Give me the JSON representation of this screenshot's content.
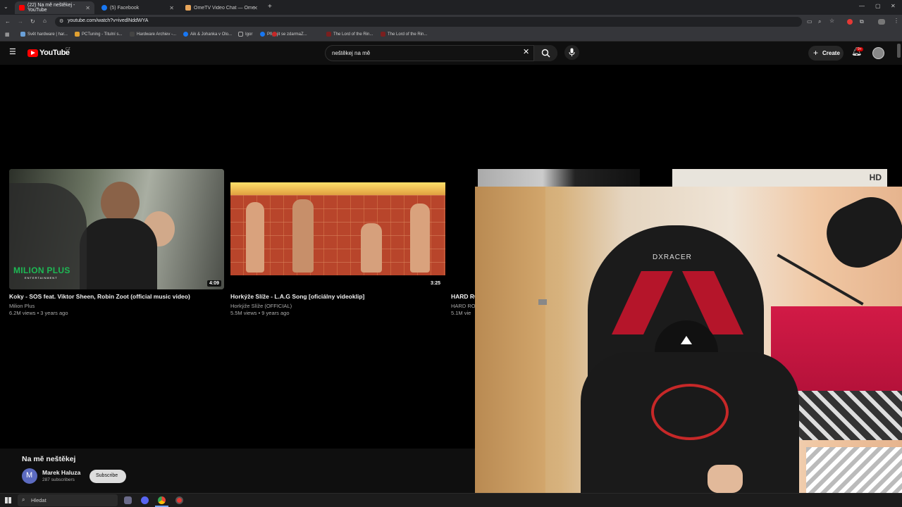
{
  "tabs": [
    {
      "label": "(22) Na mě neštěkej - YouTube",
      "active": true
    },
    {
      "label": "(5) Facebook",
      "active": false
    },
    {
      "label": "OmeTV Video Chat — Omegle",
      "active": false
    }
  ],
  "address": {
    "url": "youtube.com/watch?v=ivedlNddWYA"
  },
  "bookmarks": [
    "Svět hardware | har...",
    "PCTuning - Titulní s...",
    "Hardware Archiev -...",
    "Aik & Johanka v Olo...",
    "Igor",
    "Připojit se zdarmaZ...",
    "The Lord of the Rin...",
    "The Lord of the Rin..."
  ],
  "youtube": {
    "logo_text": "YouTube",
    "region": "CZ",
    "search_value": "neštěkej na mě",
    "create_label": "Create",
    "notif_badge": "9+"
  },
  "videos": [
    {
      "title": "Koky - SOS feat. Viktor Sheen, Robin Zoot (official music video)",
      "channel": "Milion Plus",
      "meta": "6.2M views • 3 years ago",
      "duration": "4:09",
      "thumb_brand": "MILION PLUS",
      "thumb_sub": "ENTERTAINMENT"
    },
    {
      "title": "Horkýže Slíže - L.A.G Song [oficiálny videoklip]",
      "channel": "Horkýže Slíže (OFFICIAL)",
      "meta": "5.5M views • 9 years ago",
      "duration": "3:25"
    },
    {
      "title": "HARD RO",
      "channel": "HARD RO",
      "meta": "5.1M vie"
    }
  ],
  "hd_badge": "HD",
  "now_playing": {
    "title": "Na mě neštěkej",
    "channel": "Marek Haluza",
    "avatar_letter": "M",
    "subscribers": "287 subscribers",
    "subscribe_label": "Subscribe"
  },
  "webcam": {
    "chair_brand": "DXRACER"
  },
  "taskbar": {
    "search_placeholder": "Hledat"
  },
  "colors": {
    "yt_red": "#ff0000",
    "bg": "#0f0f0f",
    "accent_green": "#1db954"
  }
}
